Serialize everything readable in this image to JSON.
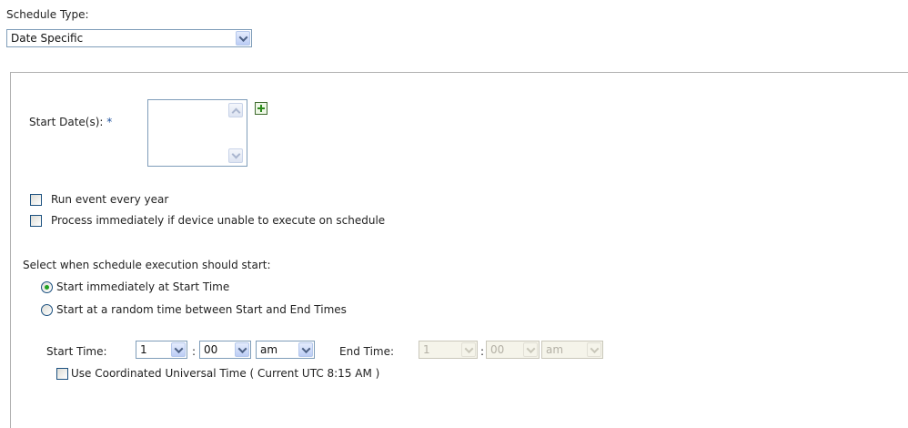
{
  "schedule_type": {
    "label": "Schedule Type:",
    "selected": "Date Specific"
  },
  "start_dates": {
    "label": "Start Date(s):",
    "required_marker": "*"
  },
  "options": {
    "run_every_year": "Run event every year",
    "process_immediately": "Process immediately if device unable to execute on schedule"
  },
  "execution": {
    "prompt": "Select when schedule execution should start:",
    "immediately": "Start immediately at Start Time",
    "random": "Start at a random time between Start and End Times",
    "selected_option": "immediately"
  },
  "times": {
    "start_label": "Start Time:",
    "start_hour": "1",
    "start_minute": "00",
    "start_ampm": "am",
    "colon": ":",
    "end_label": "End Time:",
    "end_hour": "1",
    "end_minute": "00",
    "end_ampm": "am",
    "utc_label": "Use Coordinated Universal Time ( Current UTC 8:15 AM )"
  },
  "colors": {
    "field_border": "#7f9db9",
    "required_marker": "#1c4f9c",
    "radio_dot": "#21a121",
    "add_icon": "#2c8a1c"
  }
}
